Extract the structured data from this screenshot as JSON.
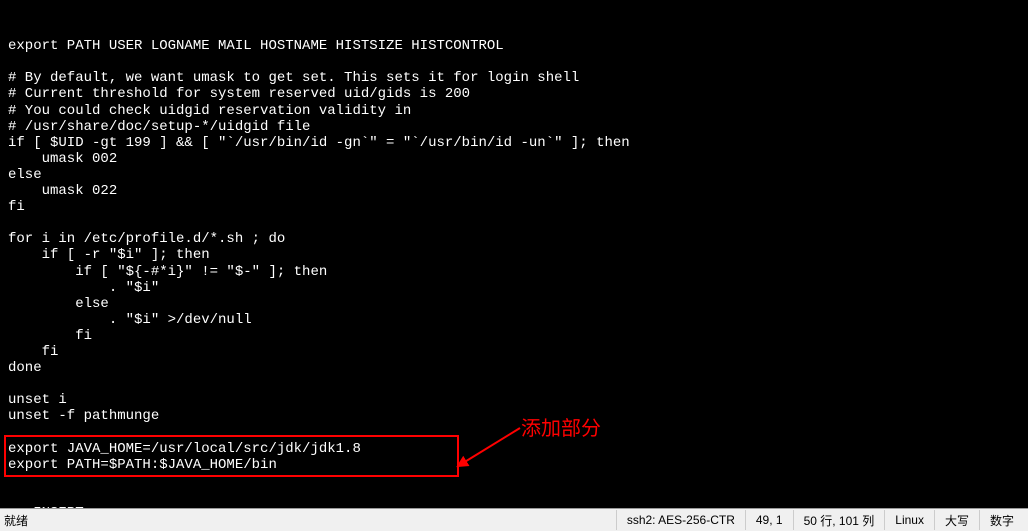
{
  "terminal": {
    "lines": [
      "export PATH USER LOGNAME MAIL HOSTNAME HISTSIZE HISTCONTROL",
      "",
      "# By default, we want umask to get set. This sets it for login shell",
      "# Current threshold for system reserved uid/gids is 200",
      "# You could check uidgid reservation validity in",
      "# /usr/share/doc/setup-*/uidgid file",
      "if [ $UID -gt 199 ] && [ \"`/usr/bin/id -gn`\" = \"`/usr/bin/id -un`\" ]; then",
      "    umask 002",
      "else",
      "    umask 022",
      "fi",
      "",
      "for i in /etc/profile.d/*.sh ; do",
      "    if [ -r \"$i\" ]; then",
      "        if [ \"${-#*i}\" != \"$-\" ]; then",
      "            . \"$i\"",
      "        else",
      "            . \"$i\" >/dev/null",
      "        fi",
      "    fi",
      "done",
      "",
      "unset i",
      "unset -f pathmunge",
      "",
      "export JAVA_HOME=/usr/local/src/jdk/jdk1.8",
      "export PATH=$PATH:$JAVA_HOME/bin",
      "",
      "",
      "-- INSERT --"
    ]
  },
  "annotation": {
    "label": "添加部分"
  },
  "status": {
    "ready": "就绪",
    "ssh": "ssh2: AES-256-CTR",
    "cursor": "49, 1",
    "size": "50 行, 101 列",
    "mode": "Linux",
    "caps": "大写",
    "num": "数字"
  },
  "watermark": ""
}
